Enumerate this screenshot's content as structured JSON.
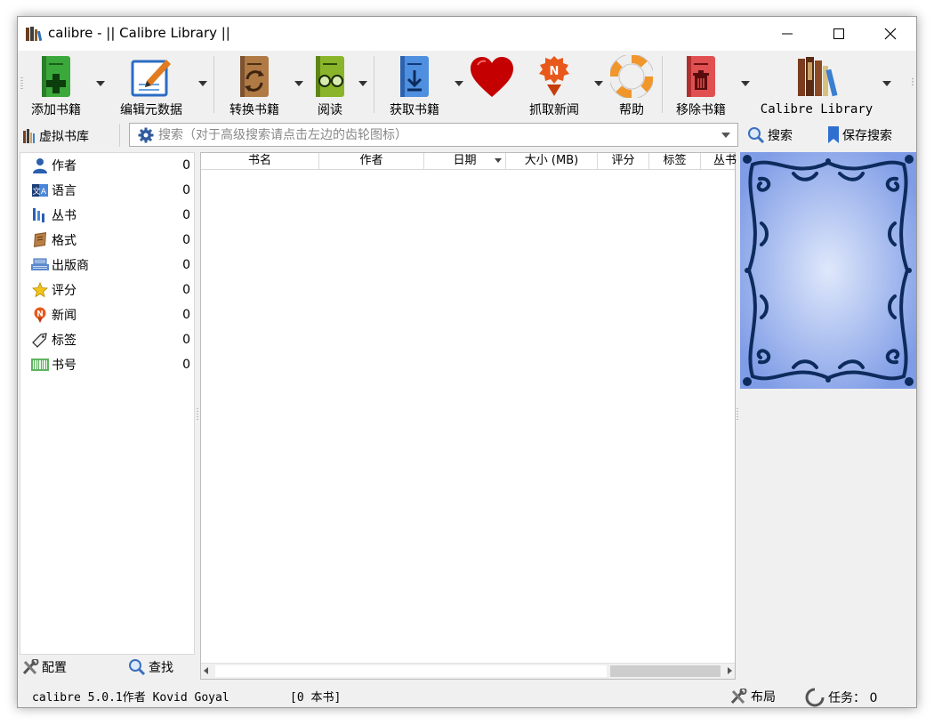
{
  "window": {
    "title": "calibre - || Calibre Library ||"
  },
  "toolbar": {
    "add_books": "添加书籍",
    "edit_metadata": "编辑元数据",
    "convert_books": "转换书籍",
    "view": "阅读",
    "get_books": "获取书籍",
    "fetch_news": "抓取新闻",
    "help": "帮助",
    "remove_books": "移除书籍",
    "library": "Calibre Library"
  },
  "searchbar": {
    "virtual_library": "虚拟书库",
    "search_placeholder": "搜索（对于高级搜索请点击左边的齿轮图标）",
    "search_button": "搜索",
    "saved_search_button": "保存搜索"
  },
  "tag_browser": {
    "items": [
      {
        "label": "作者",
        "count": "0",
        "icon": "person-icon"
      },
      {
        "label": "语言",
        "count": "0",
        "icon": "language-icon"
      },
      {
        "label": "丛书",
        "count": "0",
        "icon": "series-icon"
      },
      {
        "label": "格式",
        "count": "0",
        "icon": "book-format-icon"
      },
      {
        "label": "出版商",
        "count": "0",
        "icon": "publisher-icon"
      },
      {
        "label": "评分",
        "count": "0",
        "icon": "star-icon"
      },
      {
        "label": "新闻",
        "count": "0",
        "icon": "news-icon"
      },
      {
        "label": "标签",
        "count": "0",
        "icon": "tag-icon"
      },
      {
        "label": "书号",
        "count": "0",
        "icon": "barcode-icon"
      }
    ],
    "configure": "配置",
    "find": "查找"
  },
  "book_list": {
    "columns": [
      "书名",
      "作者",
      "日期",
      "大小 (MB)",
      "评分",
      "标签",
      "丛书"
    ]
  },
  "status": {
    "version": "calibre 5.0.1作者 Kovid Goyal",
    "book_count": "[0 本书]",
    "layout": "布局",
    "jobs": "任务： 0"
  },
  "colors": {
    "cover_blue": "#7f9ce6",
    "cover_frame": "#0d2b5c",
    "heart_red": "#c40000"
  }
}
